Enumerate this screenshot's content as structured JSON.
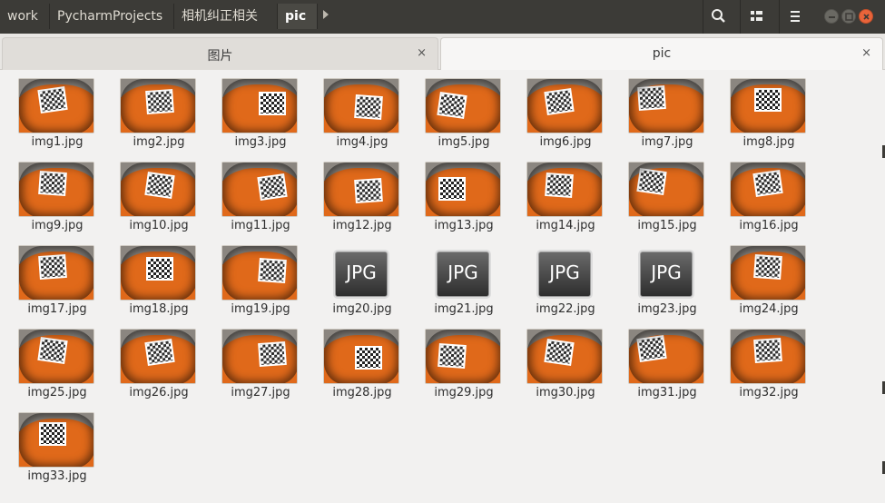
{
  "header": {
    "breadcrumbs": [
      "work",
      "PycharmProjects",
      "相机纠正相关",
      "pic"
    ],
    "active_crumb": "pic"
  },
  "tabs": [
    {
      "label": "图片",
      "close": "×",
      "active": false
    },
    {
      "label": "pic",
      "close": "×",
      "active": true
    }
  ],
  "files": [
    {
      "name": "img1.jpg",
      "kind": "photo"
    },
    {
      "name": "img2.jpg",
      "kind": "photo"
    },
    {
      "name": "img3.jpg",
      "kind": "photo"
    },
    {
      "name": "img4.jpg",
      "kind": "photo"
    },
    {
      "name": "img5.jpg",
      "kind": "photo"
    },
    {
      "name": "img6.jpg",
      "kind": "photo"
    },
    {
      "name": "img7.jpg",
      "kind": "photo"
    },
    {
      "name": "img8.jpg",
      "kind": "photo"
    },
    {
      "name": "img9.jpg",
      "kind": "photo"
    },
    {
      "name": "img10.jpg",
      "kind": "photo"
    },
    {
      "name": "img11.jpg",
      "kind": "photo"
    },
    {
      "name": "img12.jpg",
      "kind": "photo"
    },
    {
      "name": "img13.jpg",
      "kind": "photo"
    },
    {
      "name": "img14.jpg",
      "kind": "photo"
    },
    {
      "name": "img15.jpg",
      "kind": "photo"
    },
    {
      "name": "img16.jpg",
      "kind": "photo"
    },
    {
      "name": "img17.jpg",
      "kind": "photo"
    },
    {
      "name": "img18.jpg",
      "kind": "photo"
    },
    {
      "name": "img19.jpg",
      "kind": "photo"
    },
    {
      "name": "img20.jpg",
      "kind": "generic"
    },
    {
      "name": "img21.jpg",
      "kind": "generic"
    },
    {
      "name": "img22.jpg",
      "kind": "generic"
    },
    {
      "name": "img23.jpg",
      "kind": "generic"
    },
    {
      "name": "img24.jpg",
      "kind": "photo"
    },
    {
      "name": "img25.jpg",
      "kind": "photo"
    },
    {
      "name": "img26.jpg",
      "kind": "photo"
    },
    {
      "name": "img27.jpg",
      "kind": "photo"
    },
    {
      "name": "img28.jpg",
      "kind": "photo"
    },
    {
      "name": "img29.jpg",
      "kind": "photo"
    },
    {
      "name": "img30.jpg",
      "kind": "photo"
    },
    {
      "name": "img31.jpg",
      "kind": "photo"
    },
    {
      "name": "img32.jpg",
      "kind": "photo"
    },
    {
      "name": "img33.jpg",
      "kind": "photo"
    }
  ],
  "generic_icon_text": "JPG",
  "colors": {
    "header_bg": "#3c3b37",
    "close_button": "#e9643a",
    "orange_backdrop": "#e0691a"
  },
  "icons": {
    "search": "search-icon",
    "view": "view-toggle-icon",
    "menu": "hamburger-menu-icon"
  }
}
